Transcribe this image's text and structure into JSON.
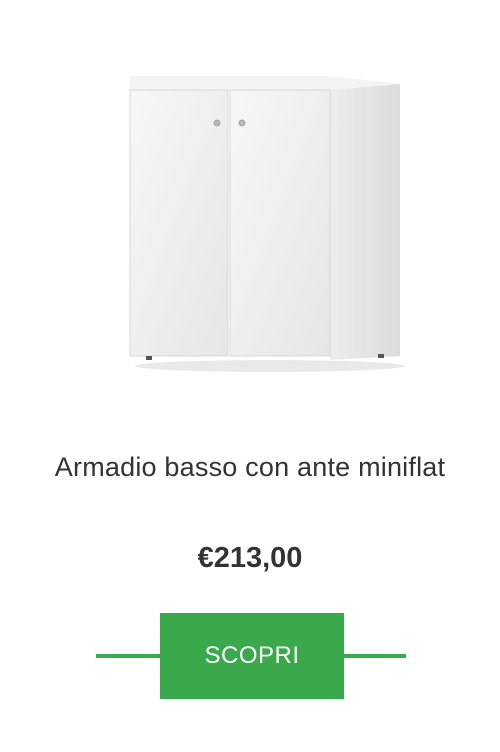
{
  "product": {
    "title": "Armadio basso con ante miniflat",
    "price": "€213,00",
    "cta_label": "SCOPRI",
    "image_icon": "cabinet-image"
  },
  "colors": {
    "accent": "#3aa94c",
    "text": "#333333"
  }
}
